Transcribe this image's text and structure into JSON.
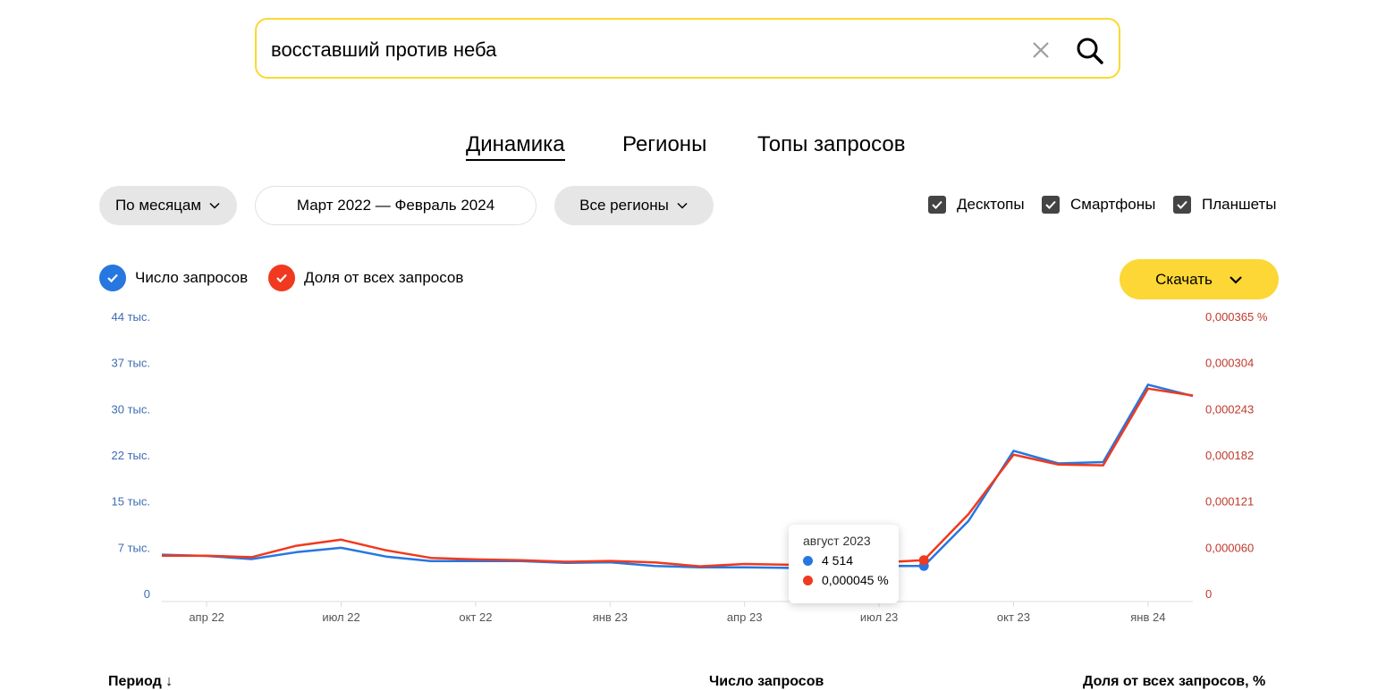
{
  "search": {
    "query": "восставший против неба",
    "clear_icon": "close-icon",
    "search_icon": "search-icon"
  },
  "tabs": [
    {
      "label": "Динамика",
      "active": true
    },
    {
      "label": "Регионы",
      "active": false
    },
    {
      "label": "Топы запросов",
      "active": false
    }
  ],
  "filters": {
    "period_group": "По месяцам",
    "date_range": "Март 2022 — Февраль 2024",
    "regions": "Все регионы"
  },
  "devices": [
    {
      "label": "Десктопы",
      "checked": true
    },
    {
      "label": "Смартфоны",
      "checked": true
    },
    {
      "label": "Планшеты",
      "checked": true
    }
  ],
  "legend": {
    "requests": "Число запросов",
    "share": "Доля от всех запросов"
  },
  "download": {
    "label": "Скачать"
  },
  "colors": {
    "blue": "#2677e0",
    "red": "#f0391e",
    "accent": "#fcd735"
  },
  "chart_data": {
    "type": "line",
    "x": [
      "мар 22",
      "апр 22",
      "май 22",
      "июн 22",
      "июл 22",
      "авг 22",
      "сен 22",
      "окт 22",
      "ноя 22",
      "дек 22",
      "янв 23",
      "фев 23",
      "мар 23",
      "апр 23",
      "май 23",
      "июн 23",
      "июл 23",
      "авг 23",
      "сен 23",
      "окт 23",
      "ноя 23",
      "дек 23",
      "янв 24",
      "фев 24"
    ],
    "x_ticks": [
      "апр 22",
      "июл 22",
      "окт 22",
      "янв 23",
      "апр 23",
      "июл 23",
      "окт 23",
      "янв 24"
    ],
    "left_axis": {
      "ticks": [
        "0",
        "7 тыс.",
        "15 тыс.",
        "22 тыс.",
        "30 тыс.",
        "37 тыс.",
        "44 тыс."
      ],
      "ylim": [
        0,
        44000
      ]
    },
    "right_axis": {
      "ticks": [
        "0",
        "0,000060",
        "0,000121",
        "0,000182",
        "0,000243",
        "0,000304",
        "0,000365 %"
      ],
      "ylim": [
        0,
        0.000365
      ]
    },
    "series": [
      {
        "name": "Число запросов",
        "axis": "left",
        "color": "#2677e0",
        "values": [
          6300,
          6100,
          5600,
          6700,
          7400,
          6000,
          5300,
          5300,
          5300,
          5000,
          5100,
          4500,
          4300,
          4300,
          4200,
          4300,
          4514,
          4514,
          11700,
          22800,
          20800,
          21000,
          33300,
          31500
        ]
      },
      {
        "name": "Доля от всех запросов",
        "axis": "right",
        "color": "#f0391e",
        "values": [
          5.1e-05,
          5.1e-05,
          4.9e-05,
          6.4e-05,
          7.2e-05,
          5.8e-05,
          4.8e-05,
          4.6e-05,
          4.5e-05,
          4.3e-05,
          4.4e-05,
          4.2e-05,
          3.7e-05,
          4e-05,
          3.9e-05,
          3.7e-05,
          4.2e-05,
          4.5e-05,
          0.000106,
          0.000184,
          0.000171,
          0.00017,
          0.000271,
          0.000262
        ]
      }
    ],
    "tooltip": {
      "period": "август 2023",
      "requests": "4 514",
      "share": "0,000045 %"
    }
  },
  "table_header": {
    "period": "Период ↓",
    "requests": "Число запросов",
    "share": "Доля от всех запросов, %"
  }
}
